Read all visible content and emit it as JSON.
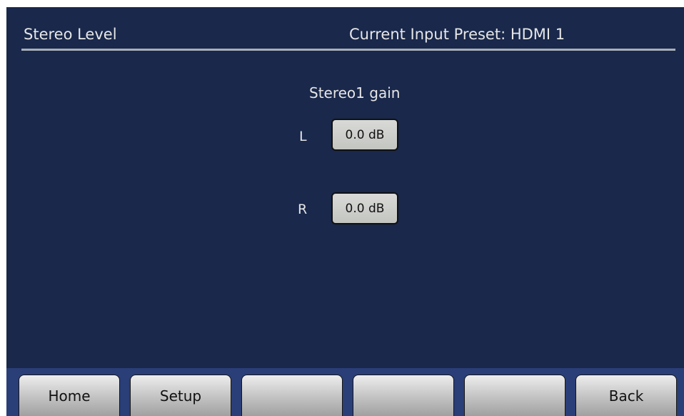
{
  "header": {
    "title": "Stereo Level",
    "preset_text": "Current Input Preset: HDMI 1"
  },
  "main": {
    "section_title": "Stereo1 gain",
    "channels": [
      {
        "label": "L",
        "value": "0.0 dB"
      },
      {
        "label": "R",
        "value": "0.0 dB"
      }
    ]
  },
  "footer": {
    "buttons": [
      {
        "label": "Home"
      },
      {
        "label": "Setup"
      },
      {
        "label": ""
      },
      {
        "label": ""
      },
      {
        "label": ""
      },
      {
        "label": "Back"
      }
    ]
  }
}
